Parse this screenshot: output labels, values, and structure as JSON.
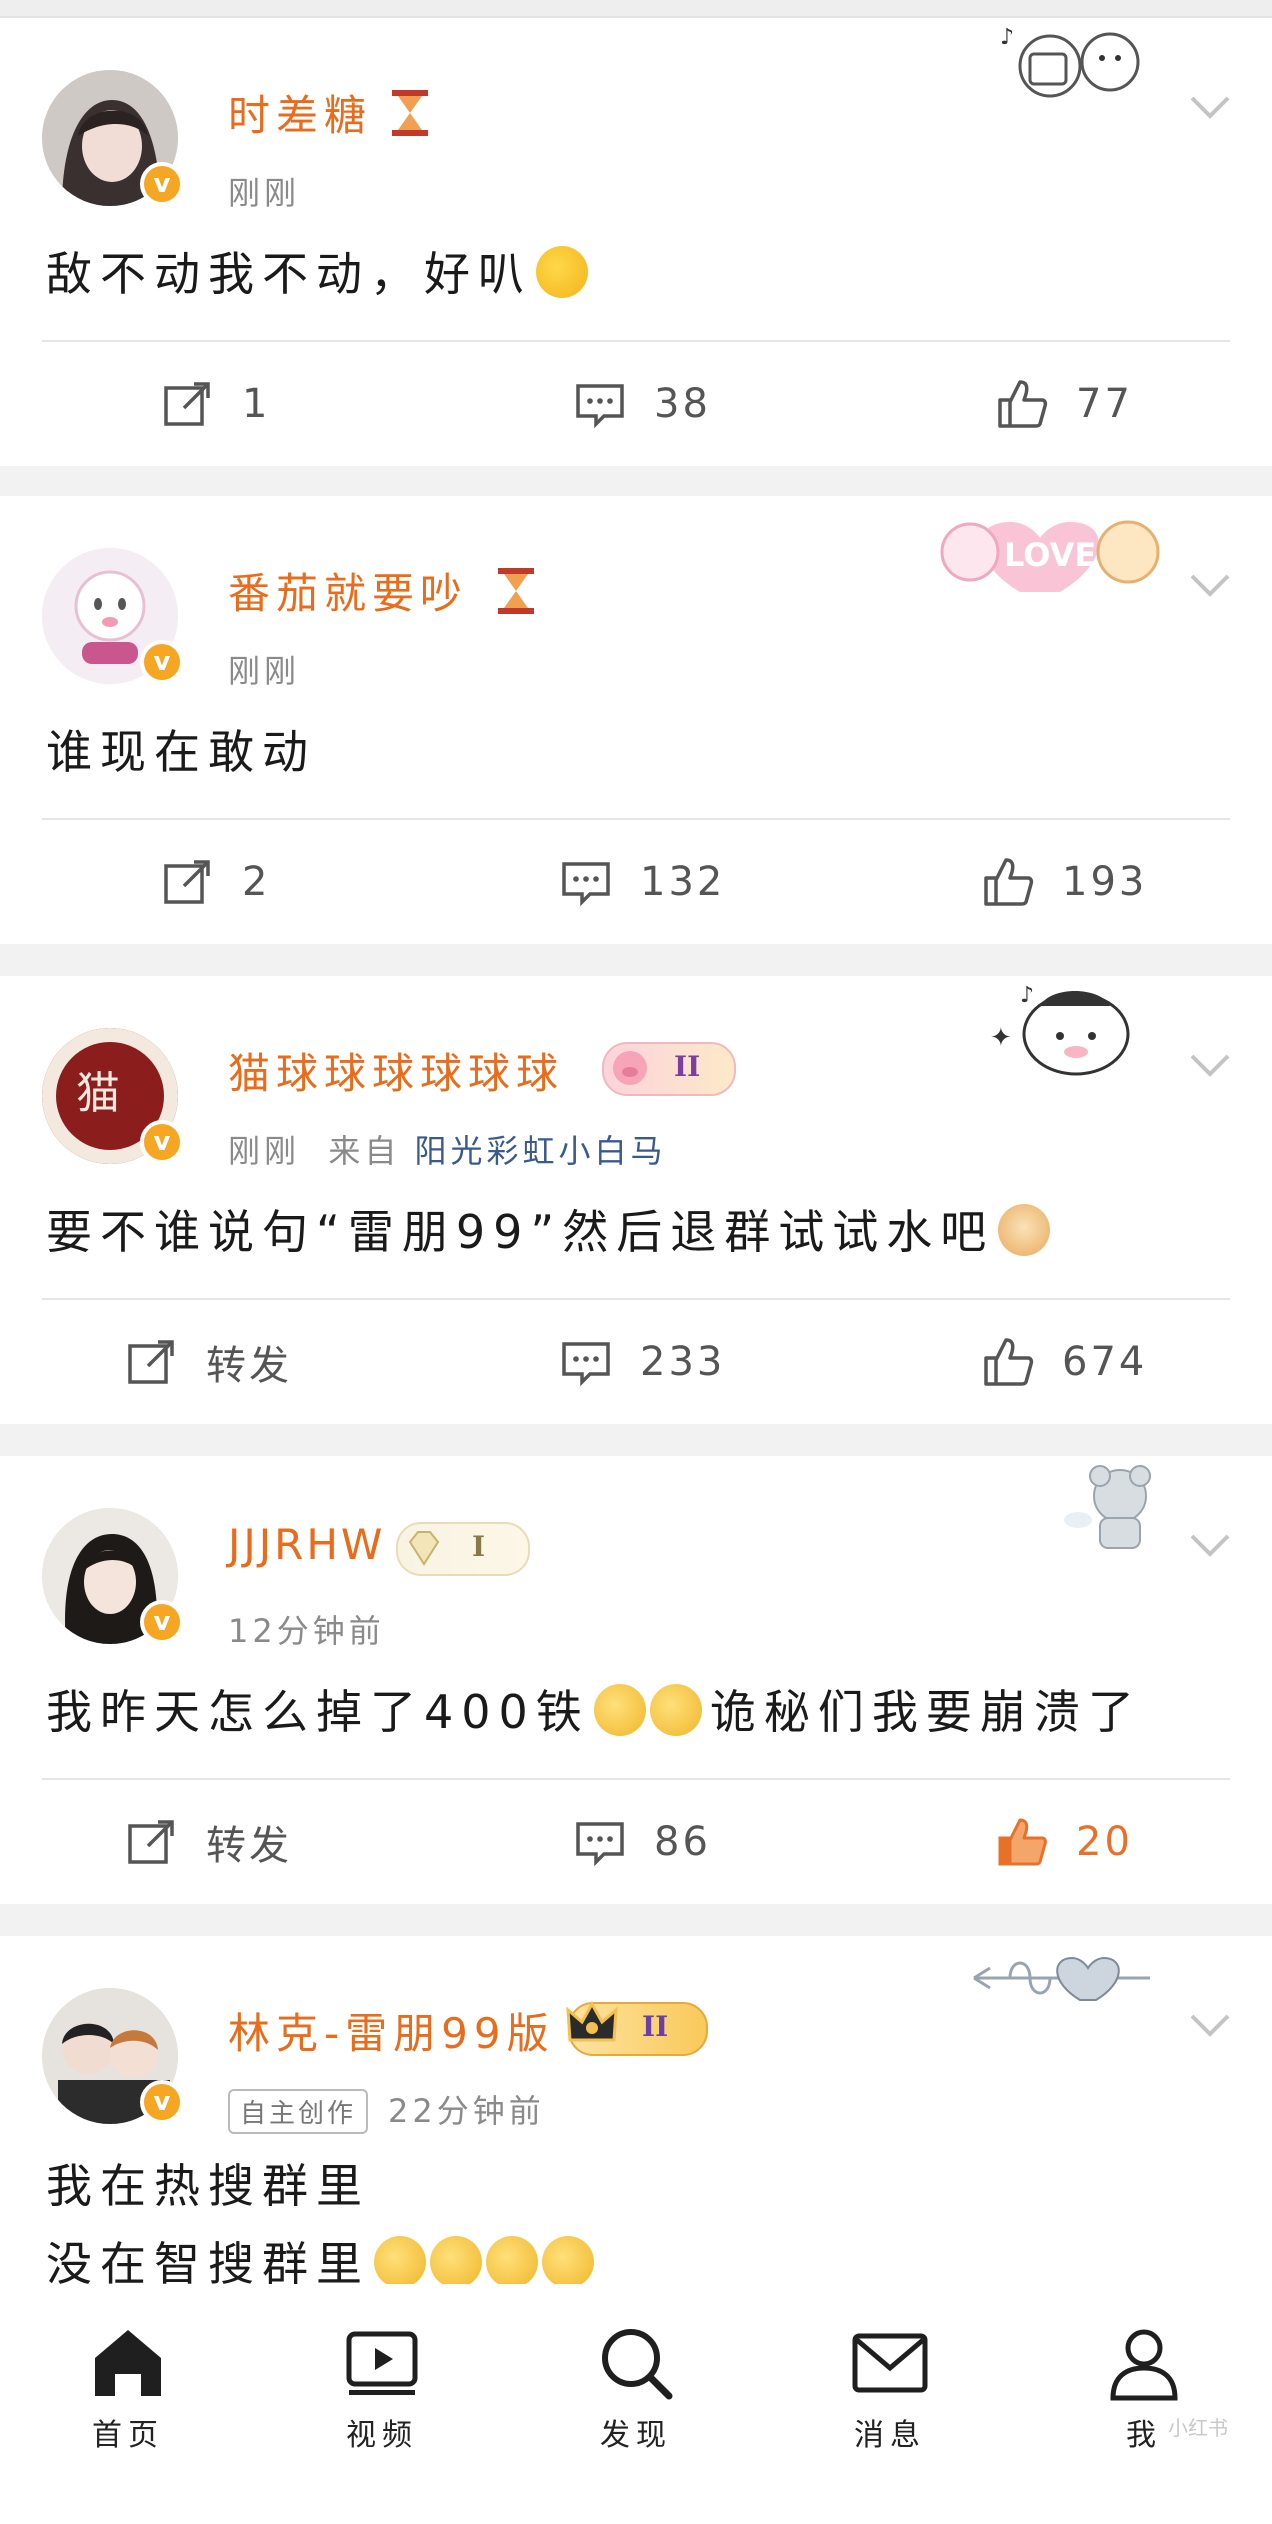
{
  "posts": [
    {
      "username": "时差糖",
      "time": "刚刚",
      "source_prefix": "",
      "source": "",
      "tag": "",
      "text_lines": [
        "敌不动我不动，好叭"
      ],
      "repost": "1",
      "comments": "38",
      "likes": "77",
      "liked": false
    },
    {
      "username": "番茄就要吵",
      "time": "刚刚",
      "source_prefix": "",
      "source": "",
      "tag": "",
      "text_lines": [
        "谁现在敢动"
      ],
      "repost": "2",
      "comments": "132",
      "likes": "193",
      "liked": false
    },
    {
      "username": "猫球球球球球球",
      "time": "刚刚",
      "source_prefix": "来自",
      "source": "阳光彩虹小白马",
      "tag": "",
      "text_lines": [
        "要不谁说句“雷朋99”然后退群试试水吧"
      ],
      "repost": "转发",
      "comments": "233",
      "likes": "674",
      "liked": false
    },
    {
      "username": "JJJRHW",
      "time": "12分钟前",
      "source_prefix": "",
      "source": "",
      "tag": "",
      "text_lines": [
        "我昨天怎么掉了400铁",
        "诡秘们我要崩溃了"
      ],
      "repost": "转发",
      "comments": "86",
      "likes": "20",
      "liked": true
    },
    {
      "username": "林克-雷朋99版",
      "time": "22分钟前",
      "source_prefix": "",
      "source": "",
      "tag": "自主创作",
      "text_lines": [
        "我在热搜群里",
        "没在智搜群里"
      ],
      "repost": "",
      "comments": "",
      "likes": "",
      "liked": false
    }
  ],
  "tabs": [
    {
      "label": "首页",
      "icon": "home-icon"
    },
    {
      "label": "视频",
      "icon": "video-icon"
    },
    {
      "label": "发现",
      "icon": "search-icon"
    },
    {
      "label": "消息",
      "icon": "mail-icon"
    },
    {
      "label": "我",
      "icon": "profile-icon"
    }
  ],
  "level_badges": [
    "II",
    "I",
    "II"
  ],
  "deco_text": "LOVE",
  "watermark": "小红书",
  "colors": {
    "accent": "#e86c1c",
    "like_active": "#e8712a",
    "verified_badge": "#f5a623",
    "background": "#f2f2f2"
  }
}
